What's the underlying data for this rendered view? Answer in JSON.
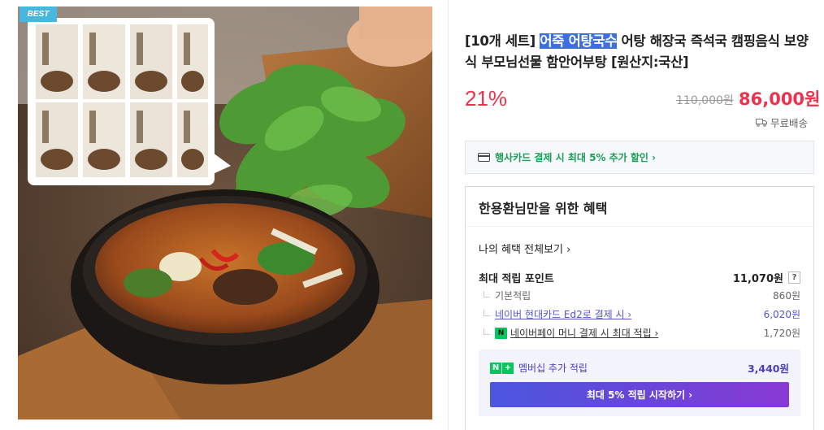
{
  "badge": {
    "label": "BEST"
  },
  "product": {
    "title_prefix": "[10개 세트] ",
    "title_highlight": "어죽 어탕국수",
    "title_rest": " 어탕 해장국 즉석국 캠핑음식 보양식 부모님선물 함안어부탕 [원산지:국산]",
    "discount": "21%",
    "original_price": "110,000원",
    "sale_price": "86,000원",
    "shipping": "무료배송"
  },
  "card_banner": {
    "text": "행사카드 결제 시 최대 5% 추가 할인 ›"
  },
  "benefits": {
    "title": "한용환님만을 위한 혜택",
    "my_benefits_link": "나의 혜택 전체보기 ›",
    "max_points_label": "최대 적립 포인트",
    "max_points_value": "11,070원",
    "help": "?",
    "rows": [
      {
        "label": "기본적립",
        "value": "860원"
      },
      {
        "label": "네이버 현대카드 Ed2로 결제 시 ›",
        "value": "6,020원"
      },
      {
        "label": "네이버페이 머니 결제 시 최대 적립 ›",
        "value": "1,720원"
      }
    ],
    "membership": {
      "label": "멤버십 추가 적립",
      "value": "3,440원",
      "button": "최대 5% 적립 시작하기 ›"
    }
  },
  "colors": {
    "accent_red": "#f0314c",
    "highlight_blue": "#3d6fde",
    "green": "#1a9e58",
    "purple": "#5a4ad8"
  },
  "icons": [
    "truck-icon",
    "card-icon",
    "question-icon",
    "npay-icon",
    "nplus-icon"
  ]
}
